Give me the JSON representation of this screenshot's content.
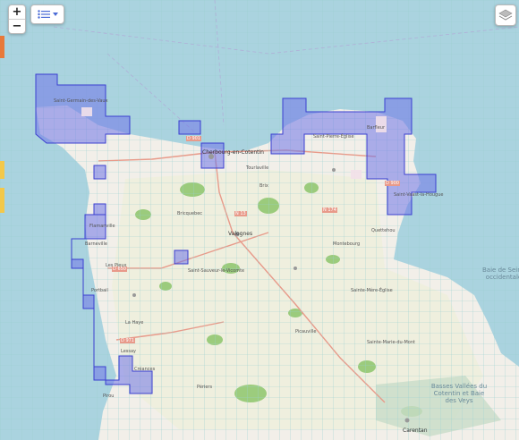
{
  "controls": {
    "zoom_in": "+",
    "zoom_out": "−",
    "legend_icon": "list-icon",
    "dropdown_icon": "chevron-down-icon",
    "layers_icon": "layers-icon"
  },
  "colors": {
    "sea": "#aad3df",
    "land": "#f2efe9",
    "coverage_fill": "#6f74e8",
    "coverage_stroke": "#3b3fcf",
    "forest": "#8dc56c",
    "grid": "#9ad0d0"
  },
  "places": [
    "Saint-Germain-des-Vaux",
    "Cherbourg-en-Cotentin",
    "Valognes",
    "Barneville",
    "Portbail",
    "Saint-Vaast-la-Hougue",
    "Montebourg",
    "Sainte-Mère-Église",
    "La Haye",
    "Périers",
    "Carentan",
    "Lessay",
    "Bricquebec",
    "Saint-Sauveur-le-Vicomte",
    "Quettehou",
    "Barfleur",
    "Tourlaville",
    "Pirou",
    "Saint-Pierre-Église",
    "Brix",
    "Flamanville",
    "Les Pieux",
    "Picauville",
    "Sainte-Marie-du-Mont",
    "Créances"
  ],
  "labels": {
    "bay1": "Baie de Seine occidentale",
    "bay2": "Basses Vallées du Cotentin et Baie des Veys"
  },
  "roads": [
    "D 901",
    "N 13",
    "D 900",
    "D 650",
    "N 174",
    "D 971"
  ]
}
